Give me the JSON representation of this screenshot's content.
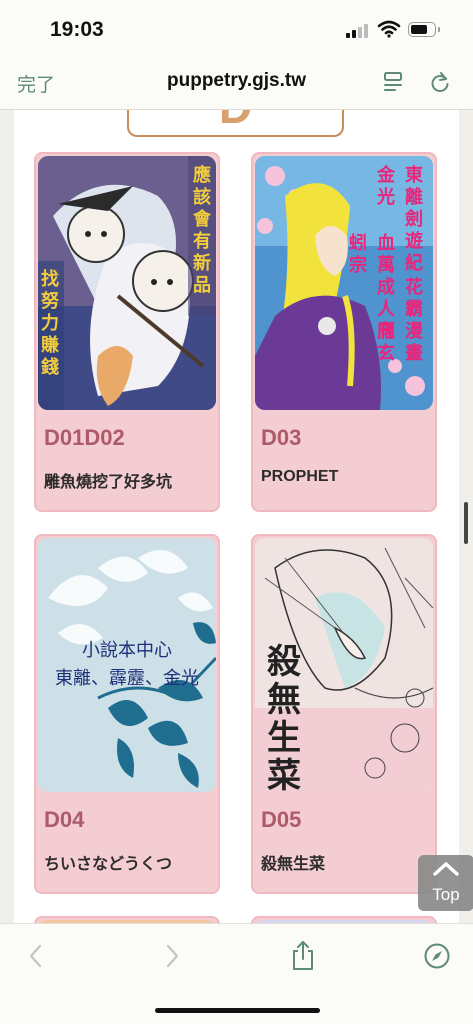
{
  "status_bar": {
    "time": "19:03",
    "battery_level": 0.75
  },
  "browser": {
    "done_label": "完了",
    "url": "puppetry.gjs.tw",
    "icons": [
      "reader-view-icon",
      "reload-icon",
      "back-icon",
      "forward-icon",
      "share-icon",
      "compass-icon"
    ]
  },
  "section": {
    "letter": "D"
  },
  "cards": [
    {
      "code": "D01D02",
      "title": "雕魚燒挖了好多坑",
      "cover_text_right": "應該會有新品",
      "cover_text_left": "找努力賺錢"
    },
    {
      "code": "D03",
      "title": "PROPHET",
      "cover_lines": [
        "東離劍遊紀",
        "金光",
        "血萬成人向",
        "蚓宗",
        "花霸漫畫",
        "雁玄"
      ]
    },
    {
      "code": "D04",
      "title": "ちいさなどうくつ",
      "cover_line1": "小說本中心",
      "cover_line2": "東離、霹靂、金光"
    },
    {
      "code": "D05",
      "title": "殺無生菜",
      "cover_chars": [
        "殺",
        "無",
        "生",
        "菜"
      ]
    }
  ],
  "top_button": {
    "label": "Top"
  },
  "colors": {
    "accent": "#5f8a73",
    "card_bg": "#f4cdd2",
    "code": "#ad5a6a",
    "border": "#c58e58"
  }
}
